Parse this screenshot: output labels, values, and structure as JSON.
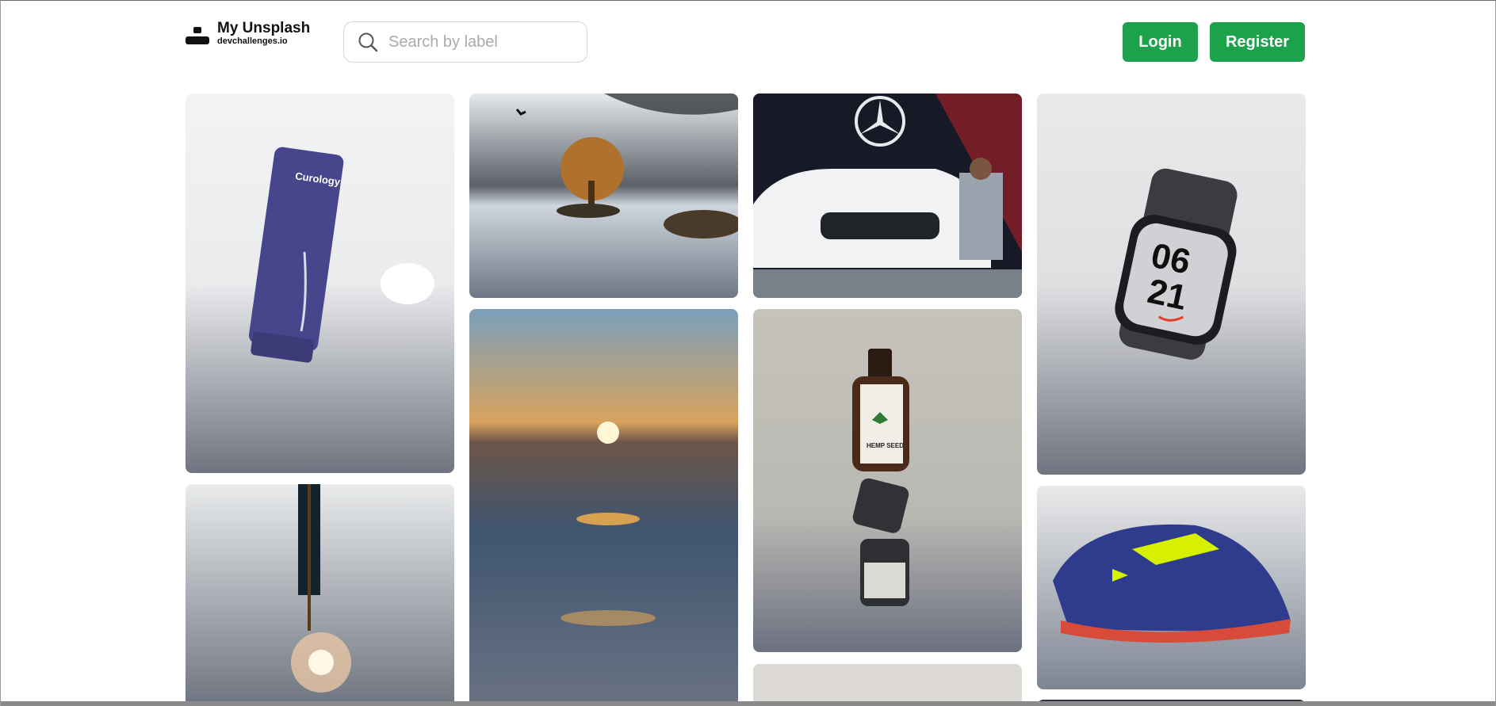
{
  "app": {
    "title": "My Unsplash",
    "subtitle": "devchallenges.io",
    "logo_icon": "user-icon"
  },
  "search": {
    "placeholder": "Search by label",
    "value": "",
    "icon": "search-icon"
  },
  "auth": {
    "login_label": "Login",
    "register_label": "Register"
  },
  "colors": {
    "accent": "#1ba24a",
    "text": "#111111",
    "placeholder": "#aaaaaa"
  },
  "photos": [
    {
      "subject": "Purple skincare tube",
      "brand_text": "Curology"
    },
    {
      "subject": "Lone tree on island"
    },
    {
      "subject": "White car with man",
      "subject_kind": "car"
    },
    {
      "subject": "Smartwatch",
      "watch_text_top": "06",
      "watch_text_bottom": "21"
    },
    {
      "subject": "Hanging lamp"
    },
    {
      "subject": "Sunset over sea"
    },
    {
      "subject": "Stacked cosmetic bottles",
      "label_text": "HEMP SEED"
    },
    {
      "subject": "Sneaker"
    },
    {
      "subject": "Partial photo"
    },
    {
      "subject": "Partial photo"
    }
  ]
}
